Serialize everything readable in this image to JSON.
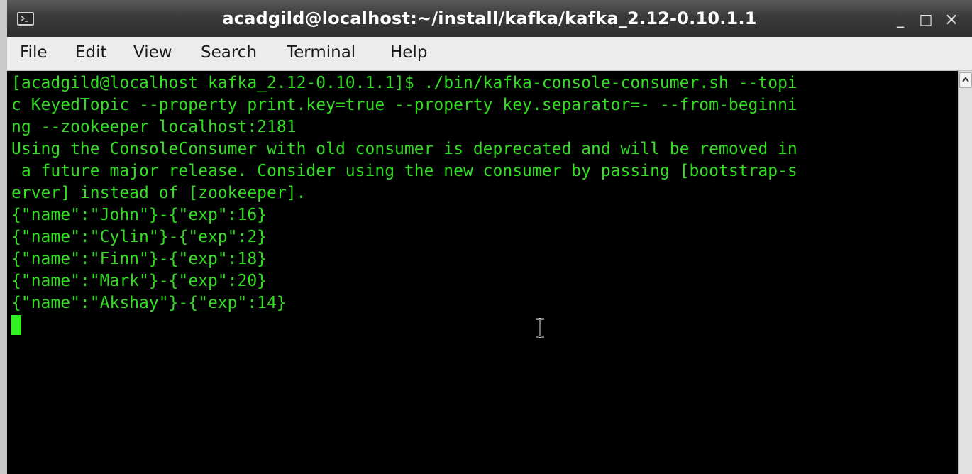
{
  "window": {
    "title": "acadgild@localhost:~/install/kafka/kafka_2.12-0.10.1.1",
    "icon": "terminal-icon",
    "controls": {
      "minimize": "_",
      "maximize": "□",
      "close": "×"
    }
  },
  "menubar": {
    "items": [
      "File",
      "Edit",
      "View",
      "Search",
      "Terminal",
      "Help"
    ]
  },
  "terminal": {
    "lines": [
      "[acadgild@localhost kafka_2.12-0.10.1.1]$ ./bin/kafka-console-consumer.sh --topi",
      "c KeyedTopic --property print.key=true --property key.separator=- --from-beginni",
      "ng --zookeeper localhost:2181",
      "Using the ConsoleConsumer with old consumer is deprecated and will be removed in",
      " a future major release. Consider using the new consumer by passing [bootstrap-s",
      "erver] instead of [zookeeper].",
      "{\"name\":\"John\"}-{\"exp\":16}",
      "{\"name\":\"Cylin\"}-{\"exp\":2}",
      "{\"name\":\"Finn\"}-{\"exp\":18}",
      "{\"name\":\"Mark\"}-{\"exp\":20}",
      "{\"name\":\"Akshay\"}-{\"exp\":14}"
    ],
    "text_color": "#33dd22",
    "background": "#000000"
  }
}
